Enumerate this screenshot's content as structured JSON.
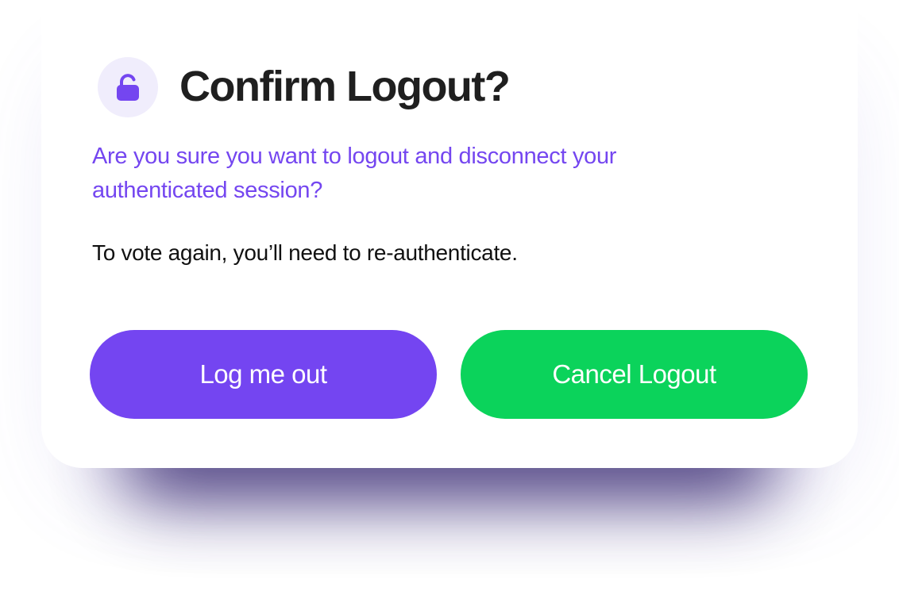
{
  "dialog": {
    "title": "Confirm Logout?",
    "icon": "unlock-icon",
    "subtitle": "Are you sure you want to logout and disconnect your authenticated session?",
    "body": "To vote again, you’ll need to re-authenticate.",
    "buttons": {
      "logout_label": "Log me out",
      "cancel_label": "Cancel Logout"
    }
  },
  "colors": {
    "accent_purple": "#7445f1",
    "accent_green": "#0bd35b",
    "icon_bg": "#f0edfc",
    "title_text": "#1f1f1f"
  }
}
